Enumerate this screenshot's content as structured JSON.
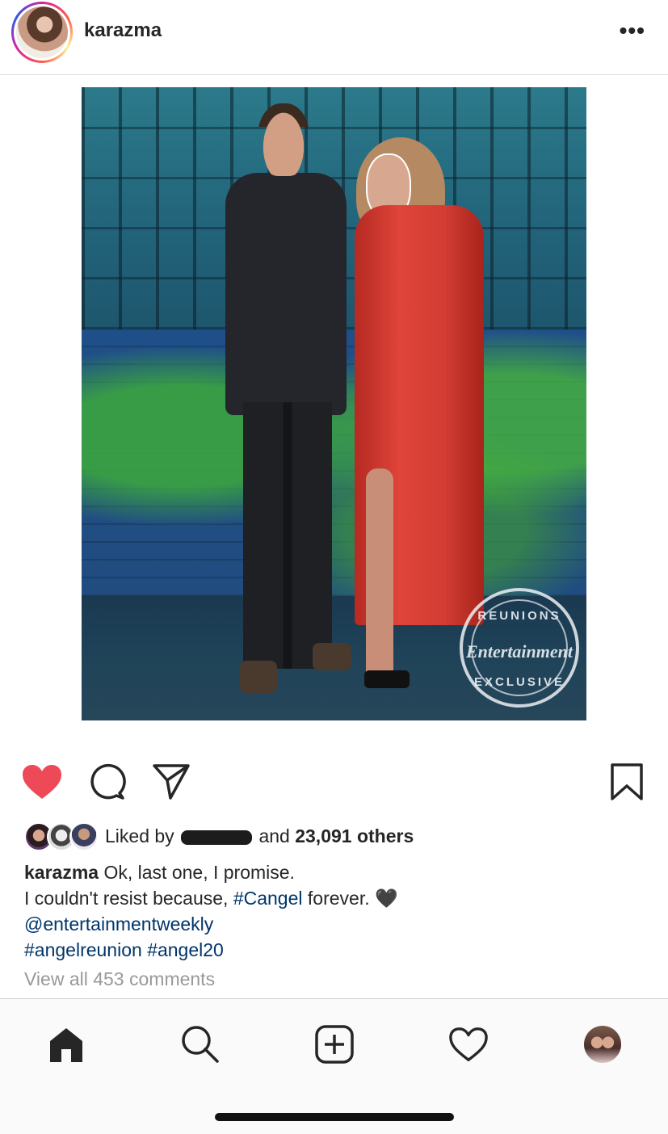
{
  "header": {
    "username": "karazma",
    "more_icon": "more-horizontal-icon"
  },
  "post": {
    "image_stamp": {
      "top": "REUNIONS",
      "brand": "Entertainment",
      "bottom": "EXCLUSIVE"
    }
  },
  "actions": {
    "like_icon": "heart-filled-icon",
    "like_color": "#ed4956",
    "comment_icon": "comment-icon",
    "share_icon": "paper-plane-icon",
    "save_icon": "bookmark-icon"
  },
  "likes": {
    "prefix": "Liked by",
    "connector": "and",
    "count_text": "23,091 others"
  },
  "caption": {
    "username": "karazma",
    "line1": "Ok, last one, I promise.",
    "line2_text": "I couldn't resist because, ",
    "line2_tag": "#Cangel",
    "line2_end": " forever. 🖤",
    "mention": "@entertainmentweekly",
    "tag1": "#angelreunion",
    "tag2": "#angel20"
  },
  "comments": {
    "view_all": "View all 453 comments"
  },
  "tabbar": {
    "items": [
      {
        "name": "home",
        "icon": "home-icon"
      },
      {
        "name": "search",
        "icon": "search-icon"
      },
      {
        "name": "add",
        "icon": "add-post-icon"
      },
      {
        "name": "activity",
        "icon": "heart-outline-icon"
      },
      {
        "name": "profile",
        "icon": "profile-avatar"
      }
    ]
  }
}
